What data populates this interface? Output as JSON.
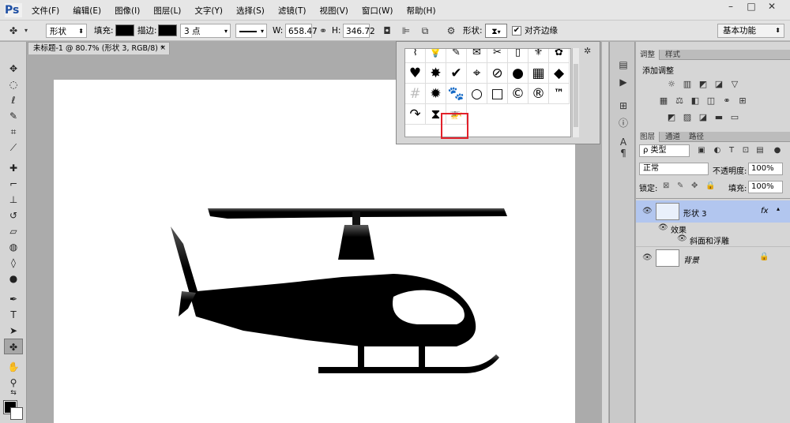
{
  "app": {
    "logo": "Ps",
    "menu": [
      "文件(F)",
      "编辑(E)",
      "图像(I)",
      "图层(L)",
      "文字(Y)",
      "选择(S)",
      "滤镜(T)",
      "视图(V)",
      "窗口(W)",
      "帮助(H)"
    ],
    "window_buttons": [
      "–",
      "□",
      "✕"
    ]
  },
  "options_bar": {
    "tool_icon": "custom-shape-tool-icon",
    "mode": "形状",
    "fill_label": "填充:",
    "stroke_label": "描边:",
    "stroke_size": "3 点",
    "width_label": "W:",
    "width_value": "658.47",
    "height_label": "H:",
    "height_value": "346.72",
    "shape_label": "形状:",
    "align_edges": "对齐边缘",
    "workspace": "基本功能"
  },
  "document": {
    "tab_title": "未标题-1 @ 80.7% (形状 3, RGB/8) *",
    "close": "×"
  },
  "shape_picker": {
    "shapes": [
      "⌇",
      "💡",
      "✎",
      "✉",
      "✂",
      "▯",
      "⚜",
      "✿",
      "♥",
      "✸",
      "✔",
      "⌖",
      "⊘",
      "●",
      "▦",
      "◆",
      "#",
      "✹",
      "🐾",
      "○",
      "□",
      "©",
      "®",
      "™",
      "↷",
      "⧗",
      "🚁"
    ],
    "selected_index": 26
  },
  "panels": {
    "adjust_tabs": [
      "调整",
      "样式"
    ],
    "adjust_title": "添加调整",
    "layers_tabs": [
      "图层",
      "通道",
      "路径"
    ],
    "filter_kind": "ρ 类型",
    "blend_mode": "正常",
    "opacity_label": "不透明度:",
    "opacity_value": "100%",
    "lock_label": "锁定:",
    "fill_label": "填充:",
    "fill_value": "100%",
    "layers": [
      {
        "name": "形状 3",
        "fx": "fx",
        "effects_label": "效果",
        "effect_item": "斜面和浮雕"
      },
      {
        "name": "背景"
      }
    ]
  },
  "colors": {
    "accent_highlight": "#e2202a",
    "selected_layer": "#b2c6ef",
    "shape_fill": "#000000"
  }
}
